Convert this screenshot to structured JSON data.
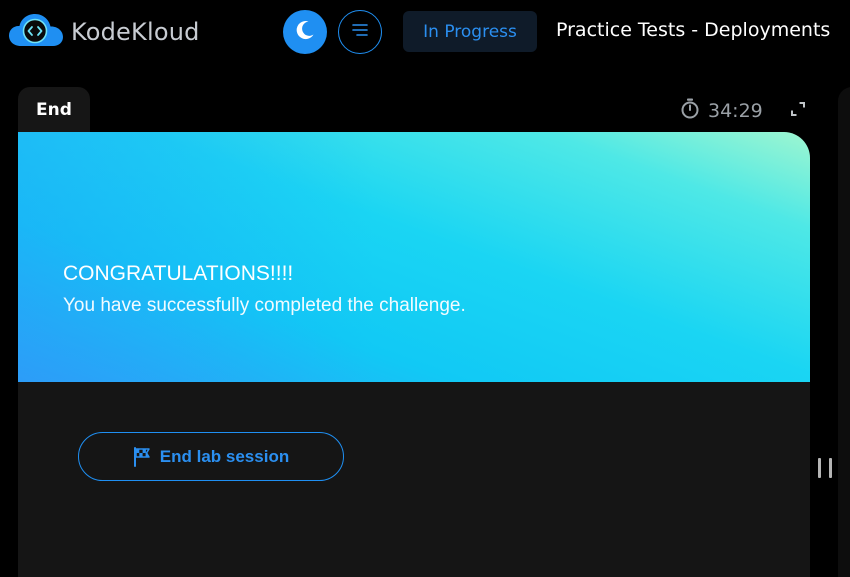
{
  "header": {
    "brand": "KodeKloud",
    "status": "In Progress",
    "page_title": "Practice Tests - Deployments"
  },
  "tab": {
    "label": "End"
  },
  "timer": {
    "value": "34:29"
  },
  "banner": {
    "title": "CONGRATULATIONS!!!!",
    "subtitle": "You have successfully completed the challenge."
  },
  "actions": {
    "end_lab_label": "End lab session"
  },
  "icons": {
    "logo": "kodekloud-cloud-logo",
    "theme": "moon-icon",
    "menu": "menu-icon",
    "timer": "stopwatch-icon",
    "expand": "expand-icon",
    "flag": "checkered-flag-icon",
    "handle": "drag-handle-icon"
  },
  "colors": {
    "accent": "#1f8ff2",
    "background": "#000000",
    "panel": "#151515",
    "banner_start": "#2ea0f7",
    "banner_end": "#9ef6d0"
  }
}
